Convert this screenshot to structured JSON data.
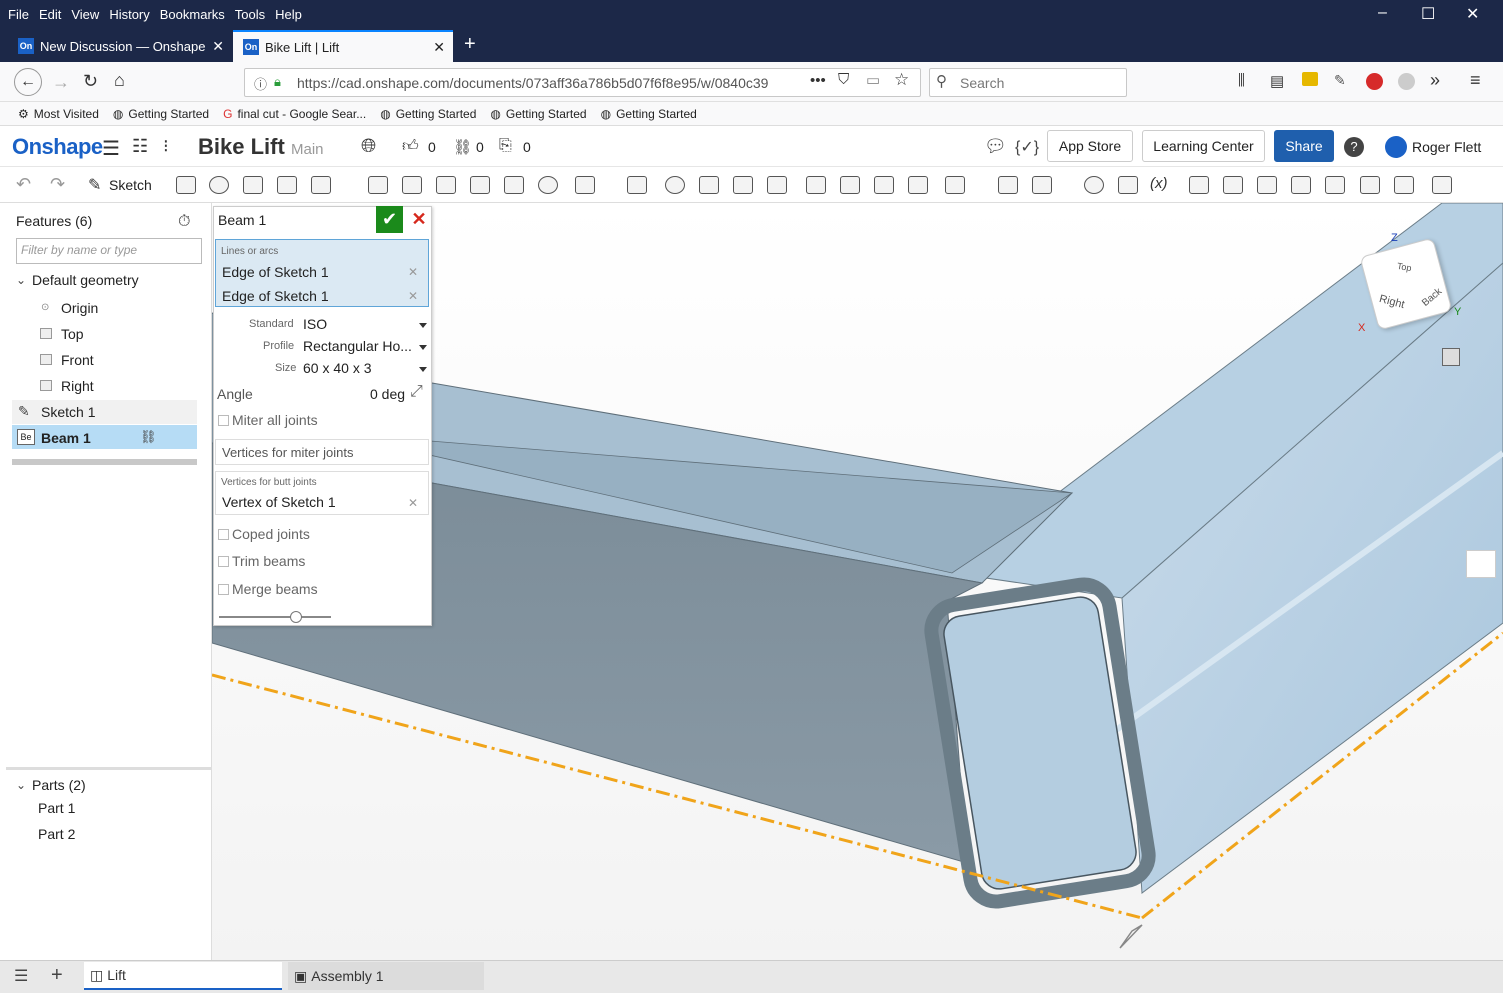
{
  "menubar": {
    "items": [
      "File",
      "Edit",
      "View",
      "History",
      "Bookmarks",
      "Tools",
      "Help"
    ]
  },
  "browser_tabs": [
    {
      "label": "New Discussion — Onshape",
      "favicon": "On",
      "active": false
    },
    {
      "label": "Bike Lift | Lift",
      "favicon": "On",
      "active": true
    }
  ],
  "url": "https://cad.onshape.com/documents/073aff36a786b5d07f6f8e95/w/0840c39",
  "search_placeholder": "Search",
  "bookmarks": [
    {
      "label": "Most Visited",
      "icon": "gear-icon"
    },
    {
      "label": "Getting Started",
      "icon": "globe-icon"
    },
    {
      "label": "final cut - Google Sear...",
      "icon": "google-icon"
    },
    {
      "label": "Getting Started",
      "icon": "globe-icon"
    },
    {
      "label": "Getting Started",
      "icon": "globe-icon"
    },
    {
      "label": "Getting Started",
      "icon": "globe-icon"
    }
  ],
  "onshape": {
    "logo": "Onshape",
    "doc_title": "Bike Lift",
    "workspace": "Main",
    "likes": "0",
    "links": "0",
    "copies": "0",
    "app_store": "App Store",
    "learning_center": "Learning Center",
    "share": "Share",
    "user": "Roger Flett",
    "sketch_label": "Sketch"
  },
  "features": {
    "header": "Features (6)",
    "filter_placeholder": "Filter by name or type",
    "default_geometry": "Default geometry",
    "items": [
      "Origin",
      "Top",
      "Front",
      "Right"
    ],
    "sketch": "Sketch 1",
    "beam": "Beam 1"
  },
  "parts": {
    "header": "Parts (2)",
    "items": [
      "Part 1",
      "Part 2"
    ]
  },
  "dialog": {
    "title": "Beam 1",
    "lines_label": "Lines or arcs",
    "lines": [
      "Edge of Sketch 1",
      "Edge of Sketch 1"
    ],
    "standard_label": "Standard",
    "standard_value": "ISO",
    "profile_label": "Profile",
    "profile_value": "Rectangular Ho...",
    "size_label": "Size",
    "size_value": "60 x 40 x 3",
    "angle_label": "Angle",
    "angle_value": "0 deg",
    "miter_all": "Miter all joints",
    "miter_vertices": "Vertices for miter joints",
    "butt_label": "Vertices for butt joints",
    "butt_value": "Vertex of Sketch 1",
    "coped": "Coped joints",
    "trim": "Trim beams",
    "merge": "Merge beams"
  },
  "viewcube": {
    "faces": [
      "Right",
      "Back",
      "Top"
    ],
    "axes": [
      "Z",
      "Y",
      "X"
    ]
  },
  "bottom_tabs": [
    {
      "label": "Lift",
      "active": true
    },
    {
      "label": "Assembly 1",
      "active": false
    }
  ],
  "colors": {
    "brand": "#1a61c6",
    "share": "#1f5fad",
    "accept": "#1b8a1b",
    "cancel": "#d6281c",
    "beam": "#a9c6dd",
    "axis": "#f0a41a"
  }
}
